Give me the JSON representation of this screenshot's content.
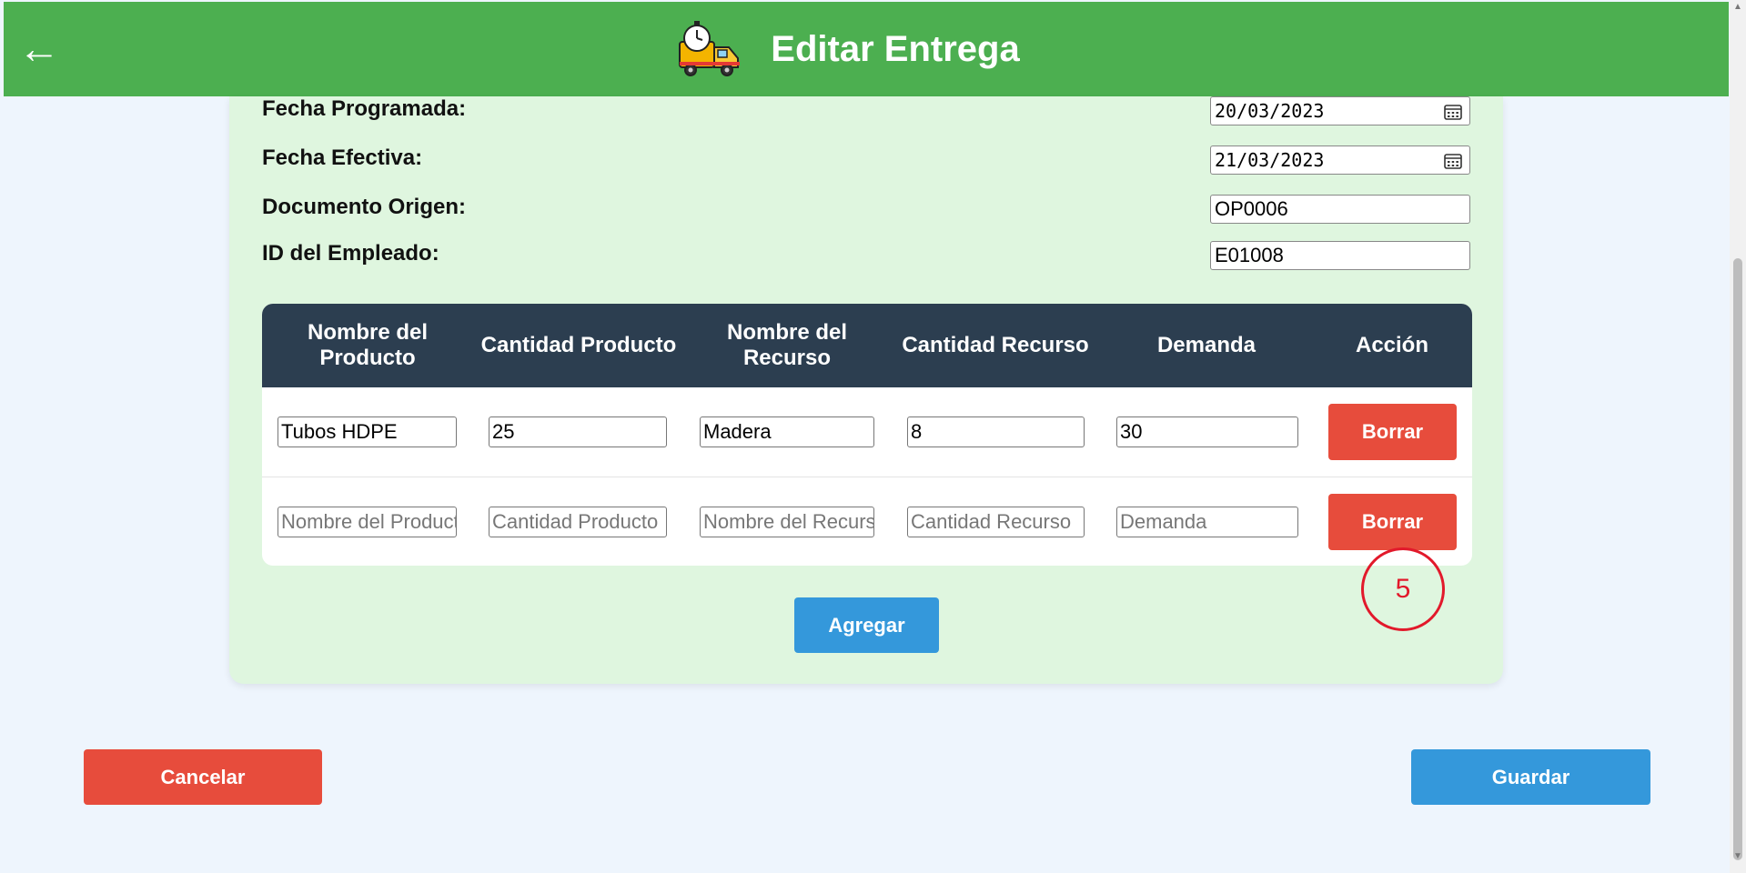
{
  "header": {
    "back_arrow": "←",
    "title": "Editar Entrega",
    "icon": "delivery-truck-timer-icon"
  },
  "form": {
    "fecha_programada": {
      "label": "Fecha Programada:",
      "value": "20/03/2023"
    },
    "fecha_efectiva": {
      "label": "Fecha Efectiva:",
      "value": "21/03/2023"
    },
    "documento_origen": {
      "label": "Documento Origen:",
      "value": "OP0006"
    },
    "id_empleado": {
      "label": "ID del Empleado:",
      "value": "E01008"
    }
  },
  "table": {
    "headers": [
      "Nombre del Producto",
      "Cantidad Producto",
      "Nombre del Recurso",
      "Cantidad Recurso",
      "Demanda",
      "Acción"
    ],
    "rows": [
      {
        "nombre_producto": "Tubos HDPE",
        "cantidad_producto": "25",
        "nombre_recurso": "Madera",
        "cantidad_recurso": "8",
        "demanda": "30",
        "action": "Borrar"
      },
      {
        "nombre_producto": "Nombre del Producto",
        "cantidad_producto": "Cantidad Producto",
        "nombre_recurso": "Nombre del Recurso",
        "cantidad_recurso": "Cantidad Recurso",
        "demanda": "Demanda",
        "action": "Borrar"
      }
    ]
  },
  "buttons": {
    "agregar": "Agregar",
    "cancelar": "Cancelar",
    "guardar": "Guardar"
  },
  "annotation": {
    "label": "5"
  },
  "colors": {
    "header_green": "#4caf50",
    "card_green": "#dff6df",
    "table_header": "#2c3e50",
    "danger": "#e74c3c",
    "primary": "#3498db",
    "annotation_red": "#e2192b"
  }
}
